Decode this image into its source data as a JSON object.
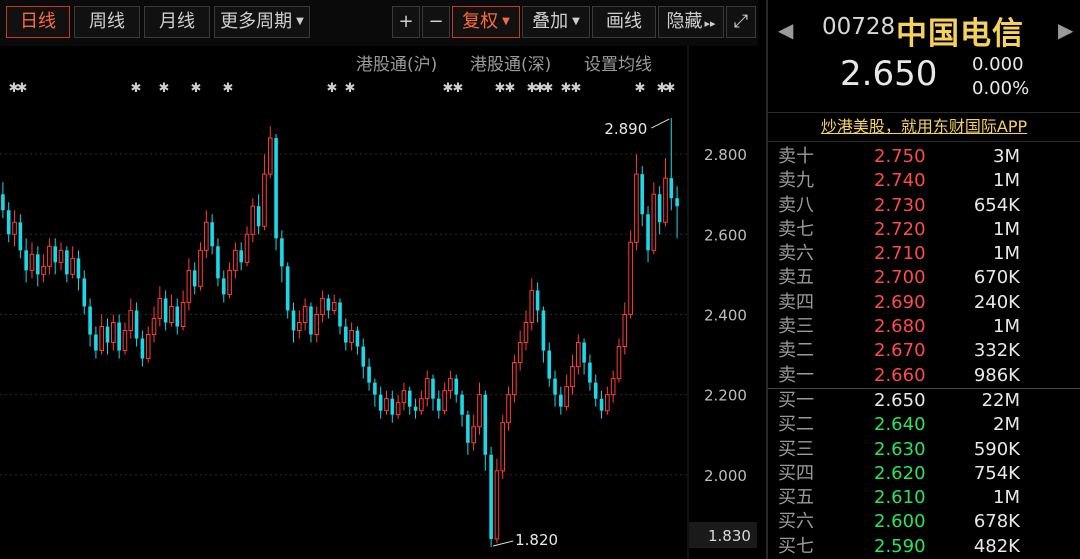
{
  "toolbar": {
    "daily": "日线",
    "weekly": "周线",
    "monthly": "月线",
    "more_periods": "更多周期",
    "plus": "+",
    "minus": "−",
    "adjust": "复权",
    "overlay": "叠加",
    "draw": "画线",
    "hide": "隐藏",
    "more_icon": "▸▸",
    "fullscreen_icon": "⤢"
  },
  "chart_header": {
    "hk_sh": "港股通(沪)",
    "hk_sz": "港股通(深)",
    "ma_settings": "设置均线"
  },
  "chart_data": {
    "type": "candlestick",
    "y_ticks": [
      "2.800",
      "2.600",
      "2.400",
      "2.200",
      "2.000"
    ],
    "current_axis_label": "1.830",
    "ylim": [
      1.81,
      2.92
    ],
    "max_label": "2.890",
    "min_label": "1.820",
    "colors": {
      "up": "#ff3b3b",
      "down": "#19d8e8",
      "grid": "#2a2a2a"
    },
    "candles": [
      [
        2.7,
        2.66,
        2.73,
        2.64
      ],
      [
        2.66,
        2.6,
        2.68,
        2.58
      ],
      [
        2.6,
        2.63,
        2.66,
        2.57
      ],
      [
        2.63,
        2.56,
        2.65,
        2.54
      ],
      [
        2.56,
        2.51,
        2.59,
        2.48
      ],
      [
        2.51,
        2.55,
        2.58,
        2.49
      ],
      [
        2.55,
        2.5,
        2.57,
        2.47
      ],
      [
        2.5,
        2.52,
        2.55,
        2.48
      ],
      [
        2.52,
        2.57,
        2.59,
        2.5
      ],
      [
        2.57,
        2.53,
        2.59,
        2.5
      ],
      [
        2.53,
        2.56,
        2.58,
        2.51
      ],
      [
        2.56,
        2.5,
        2.57,
        2.48
      ],
      [
        2.5,
        2.54,
        2.57,
        2.49
      ],
      [
        2.54,
        2.49,
        2.56,
        2.46
      ],
      [
        2.49,
        2.42,
        2.51,
        2.4
      ],
      [
        2.42,
        2.35,
        2.44,
        2.32
      ],
      [
        2.35,
        2.31,
        2.37,
        2.29
      ],
      [
        2.31,
        2.37,
        2.4,
        2.3
      ],
      [
        2.37,
        2.33,
        2.39,
        2.3
      ],
      [
        2.33,
        2.38,
        2.4,
        2.31
      ],
      [
        2.38,
        2.31,
        2.4,
        2.29
      ],
      [
        2.31,
        2.36,
        2.38,
        2.3
      ],
      [
        2.36,
        2.41,
        2.44,
        2.34
      ],
      [
        2.41,
        2.34,
        2.43,
        2.32
      ],
      [
        2.34,
        2.29,
        2.36,
        2.27
      ],
      [
        2.29,
        2.35,
        2.37,
        2.28
      ],
      [
        2.35,
        2.39,
        2.42,
        2.33
      ],
      [
        2.39,
        2.44,
        2.47,
        2.37
      ],
      [
        2.44,
        2.38,
        2.46,
        2.36
      ],
      [
        2.38,
        2.42,
        2.45,
        2.37
      ],
      [
        2.42,
        2.37,
        2.44,
        2.35
      ],
      [
        2.37,
        2.43,
        2.46,
        2.36
      ],
      [
        2.43,
        2.51,
        2.54,
        2.41
      ],
      [
        2.51,
        2.47,
        2.53,
        2.45
      ],
      [
        2.47,
        2.56,
        2.58,
        2.46
      ],
      [
        2.56,
        2.63,
        2.66,
        2.54
      ],
      [
        2.63,
        2.57,
        2.65,
        2.55
      ],
      [
        2.57,
        2.49,
        2.59,
        2.47
      ],
      [
        2.49,
        2.45,
        2.51,
        2.43
      ],
      [
        2.45,
        2.51,
        2.53,
        2.44
      ],
      [
        2.51,
        2.56,
        2.58,
        2.49
      ],
      [
        2.56,
        2.53,
        2.58,
        2.51
      ],
      [
        2.53,
        2.6,
        2.62,
        2.52
      ],
      [
        2.6,
        2.67,
        2.69,
        2.58
      ],
      [
        2.67,
        2.62,
        2.7,
        2.6
      ],
      [
        2.62,
        2.75,
        2.8,
        2.61
      ],
      [
        2.75,
        2.84,
        2.87,
        2.74
      ],
      [
        2.84,
        2.59,
        2.85,
        2.56
      ],
      [
        2.59,
        2.52,
        2.61,
        2.48
      ],
      [
        2.52,
        2.41,
        2.53,
        2.39
      ],
      [
        2.41,
        2.36,
        2.43,
        2.33
      ],
      [
        2.36,
        2.38,
        2.41,
        2.34
      ],
      [
        2.38,
        2.42,
        2.44,
        2.36
      ],
      [
        2.42,
        2.35,
        2.43,
        2.33
      ],
      [
        2.35,
        2.4,
        2.42,
        2.33
      ],
      [
        2.4,
        2.44,
        2.46,
        2.38
      ],
      [
        2.44,
        2.41,
        2.45,
        2.39
      ],
      [
        2.41,
        2.43,
        2.45,
        2.4
      ],
      [
        2.43,
        2.37,
        2.44,
        2.35
      ],
      [
        2.37,
        2.33,
        2.39,
        2.31
      ],
      [
        2.33,
        2.36,
        2.38,
        2.31
      ],
      [
        2.36,
        2.32,
        2.37,
        2.3
      ],
      [
        2.32,
        2.27,
        2.34,
        2.24
      ],
      [
        2.27,
        2.23,
        2.29,
        2.21
      ],
      [
        2.23,
        2.2,
        2.24,
        2.17
      ],
      [
        2.2,
        2.16,
        2.22,
        2.14
      ],
      [
        2.16,
        2.19,
        2.21,
        2.15
      ],
      [
        2.19,
        2.15,
        2.21,
        2.13
      ],
      [
        2.15,
        2.18,
        2.2,
        2.14
      ],
      [
        2.18,
        2.21,
        2.23,
        2.16
      ],
      [
        2.21,
        2.17,
        2.22,
        2.15
      ],
      [
        2.17,
        2.16,
        2.19,
        2.14
      ],
      [
        2.16,
        2.19,
        2.21,
        2.15
      ],
      [
        2.19,
        2.24,
        2.26,
        2.17
      ],
      [
        2.24,
        2.19,
        2.25,
        2.16
      ],
      [
        2.19,
        2.16,
        2.21,
        2.14
      ],
      [
        2.16,
        2.21,
        2.23,
        2.15
      ],
      [
        2.21,
        2.24,
        2.26,
        2.19
      ],
      [
        2.24,
        2.2,
        2.25,
        2.18
      ],
      [
        2.2,
        2.15,
        2.21,
        2.12
      ],
      [
        2.15,
        2.08,
        2.16,
        2.05
      ],
      [
        2.08,
        2.12,
        2.15,
        2.06
      ],
      [
        2.12,
        2.2,
        2.23,
        2.1
      ],
      [
        2.2,
        2.05,
        2.21,
        2.01
      ],
      [
        2.05,
        1.84,
        2.07,
        1.82
      ],
      [
        1.84,
        2.01,
        2.04,
        1.83
      ],
      [
        2.01,
        2.13,
        2.15,
        1.99
      ],
      [
        2.13,
        2.2,
        2.22,
        2.11
      ],
      [
        2.2,
        2.28,
        2.3,
        2.18
      ],
      [
        2.28,
        2.33,
        2.36,
        2.26
      ],
      [
        2.33,
        2.38,
        2.41,
        2.31
      ],
      [
        2.38,
        2.46,
        2.49,
        2.36
      ],
      [
        2.46,
        2.41,
        2.48,
        2.38
      ],
      [
        2.41,
        2.31,
        2.42,
        2.28
      ],
      [
        2.31,
        2.24,
        2.33,
        2.22
      ],
      [
        2.24,
        2.2,
        2.26,
        2.17
      ],
      [
        2.2,
        2.17,
        2.22,
        2.15
      ],
      [
        2.17,
        2.22,
        2.25,
        2.16
      ],
      [
        2.22,
        2.27,
        2.3,
        2.2
      ],
      [
        2.27,
        2.33,
        2.35,
        2.25
      ],
      [
        2.33,
        2.28,
        2.34,
        2.25
      ],
      [
        2.28,
        2.23,
        2.3,
        2.21
      ],
      [
        2.23,
        2.19,
        2.25,
        2.17
      ],
      [
        2.19,
        2.16,
        2.21,
        2.14
      ],
      [
        2.16,
        2.2,
        2.22,
        2.15
      ],
      [
        2.2,
        2.24,
        2.26,
        2.18
      ],
      [
        2.24,
        2.32,
        2.34,
        2.23
      ],
      [
        2.32,
        2.4,
        2.43,
        2.3
      ],
      [
        2.4,
        2.58,
        2.61,
        2.39
      ],
      [
        2.58,
        2.75,
        2.8,
        2.56
      ],
      [
        2.75,
        2.65,
        2.77,
        2.62
      ],
      [
        2.65,
        2.56,
        2.67,
        2.53
      ],
      [
        2.56,
        2.7,
        2.73,
        2.55
      ],
      [
        2.7,
        2.63,
        2.72,
        2.6
      ],
      [
        2.63,
        2.74,
        2.79,
        2.62
      ],
      [
        2.74,
        2.69,
        2.89,
        2.66
      ],
      [
        2.69,
        2.67,
        2.72,
        2.59
      ]
    ]
  },
  "quote": {
    "code": "00728",
    "name": "中国电信",
    "price": "2.650",
    "change": "0.000",
    "change_pct": "0.00%",
    "left_arrow": "◀",
    "right_arrow": "▶",
    "promo": "炒港美股，就用东财国际APP"
  },
  "order_book": {
    "asks": [
      {
        "label": "卖十",
        "price": "2.750",
        "vol": "3M"
      },
      {
        "label": "卖九",
        "price": "2.740",
        "vol": "1M"
      },
      {
        "label": "卖八",
        "price": "2.730",
        "vol": "654K"
      },
      {
        "label": "卖七",
        "price": "2.720",
        "vol": "1M"
      },
      {
        "label": "卖六",
        "price": "2.710",
        "vol": "1M"
      },
      {
        "label": "卖五",
        "price": "2.700",
        "vol": "670K"
      },
      {
        "label": "卖四",
        "price": "2.690",
        "vol": "240K"
      },
      {
        "label": "卖三",
        "price": "2.680",
        "vol": "1M"
      },
      {
        "label": "卖二",
        "price": "2.670",
        "vol": "332K"
      },
      {
        "label": "卖一",
        "price": "2.660",
        "vol": "986K"
      }
    ],
    "bids": [
      {
        "label": "买一",
        "price": "2.650",
        "vol": "22M"
      },
      {
        "label": "买二",
        "price": "2.640",
        "vol": "2M"
      },
      {
        "label": "买三",
        "price": "2.630",
        "vol": "590K"
      },
      {
        "label": "买四",
        "price": "2.620",
        "vol": "754K"
      },
      {
        "label": "买五",
        "price": "2.610",
        "vol": "1M"
      },
      {
        "label": "买六",
        "price": "2.600",
        "vol": "678K"
      },
      {
        "label": "买七",
        "price": "2.590",
        "vol": "482K"
      }
    ]
  }
}
